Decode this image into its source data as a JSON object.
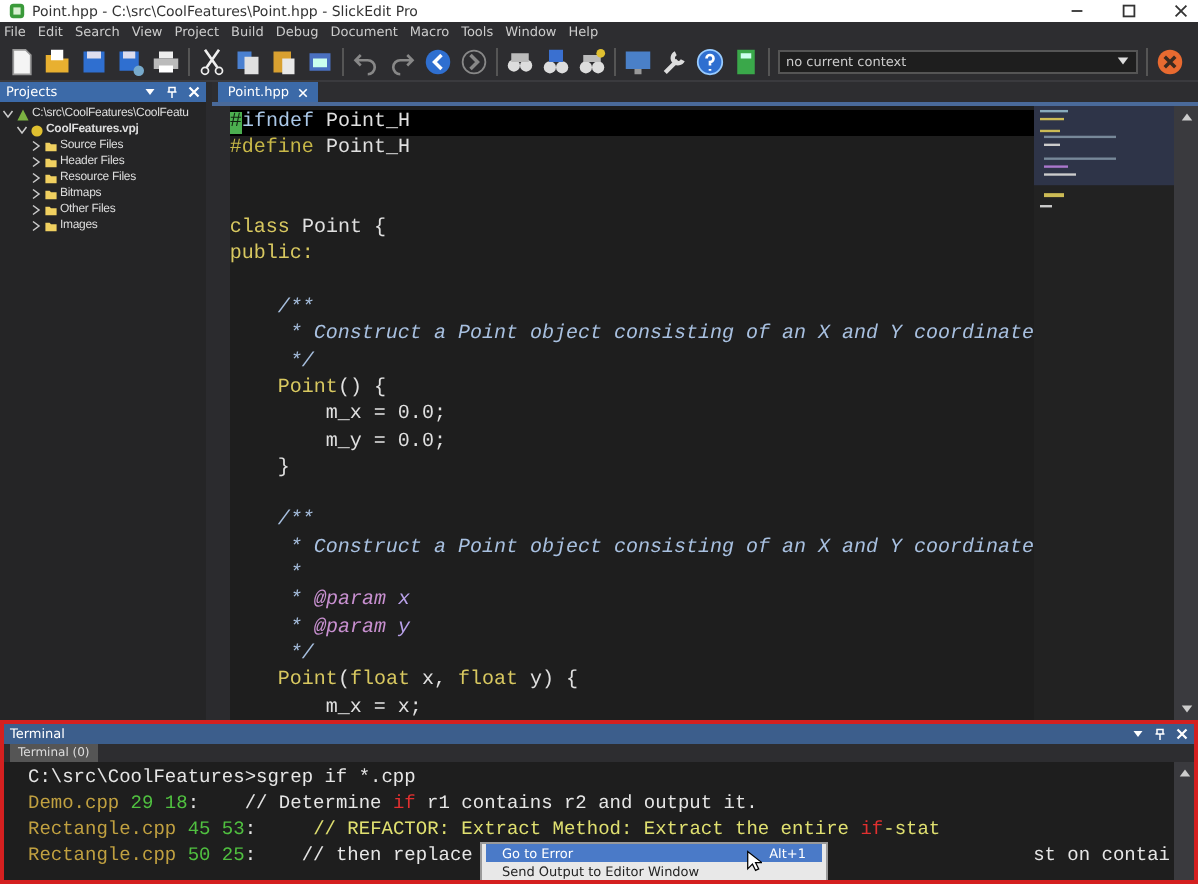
{
  "window": {
    "title": "Point.hpp - C:\\src\\CoolFeatures\\Point.hpp - SlickEdit Pro"
  },
  "menu": [
    "File",
    "Edit",
    "Search",
    "View",
    "Project",
    "Build",
    "Debug",
    "Document",
    "Macro",
    "Tools",
    "Window",
    "Help"
  ],
  "toolbar": {
    "context": {
      "value": "no current context"
    }
  },
  "projects": {
    "title": "Projects",
    "tree": [
      {
        "label": "C:\\src\\CoolFeatures\\CoolFeatu",
        "expanded": true,
        "children": [
          {
            "label": "CoolFeatures.vpj",
            "expanded": true,
            "children": [
              {
                "label": "Source Files",
                "expanded": false
              },
              {
                "label": "Header Files",
                "expanded": false
              },
              {
                "label": "Resource Files",
                "expanded": false
              },
              {
                "label": "Bitmaps",
                "expanded": false
              },
              {
                "label": "Other Files",
                "expanded": false
              },
              {
                "label": "Images",
                "expanded": false
              }
            ]
          }
        ]
      }
    ]
  },
  "editor": {
    "tabs": [
      {
        "label": "Point.hpp",
        "selected": true
      }
    ],
    "lines": [
      {
        "current": true,
        "segments": [
          {
            "kind": "cursor",
            "text": "#"
          },
          {
            "kind": "preproc",
            "text": "ifndef"
          },
          {
            "kind": "ident",
            "text": " Point_H"
          }
        ]
      },
      {
        "current": false,
        "segments": [
          {
            "kind": "define",
            "text": "#define"
          },
          {
            "kind": "ident",
            "text": " Point_H"
          }
        ]
      },
      {
        "current": false,
        "kind": "blank"
      },
      {
        "current": false,
        "kind": "blank"
      },
      {
        "current": false,
        "segments": [
          {
            "kind": "keyword",
            "text": "class"
          },
          {
            "kind": "ident",
            "text": " Point {"
          }
        ]
      },
      {
        "current": false,
        "segments": [
          {
            "kind": "keyword",
            "text": "public:"
          }
        ]
      },
      {
        "current": false,
        "kind": "blank"
      },
      {
        "current": false,
        "segments": [
          {
            "kind": "comment",
            "text": "    /**"
          }
        ]
      },
      {
        "current": false,
        "segments": [
          {
            "kind": "comment",
            "text": "     * Construct a Point object consisting of an X and Y coordinate"
          }
        ]
      },
      {
        "current": false,
        "segments": [
          {
            "kind": "comment",
            "text": "     */"
          }
        ]
      },
      {
        "current": false,
        "segments": [
          {
            "kind": "function",
            "text": "    Point"
          },
          {
            "kind": "ident",
            "text": "() {"
          }
        ]
      },
      {
        "current": false,
        "segments": [
          {
            "kind": "ident",
            "text": "        m_x = 0.0;"
          }
        ]
      },
      {
        "current": false,
        "segments": [
          {
            "kind": "ident",
            "text": "        m_y = 0.0;"
          }
        ]
      },
      {
        "current": false,
        "segments": [
          {
            "kind": "ident",
            "text": "    }"
          }
        ]
      },
      {
        "current": false,
        "kind": "blank"
      },
      {
        "current": false,
        "segments": [
          {
            "kind": "comment",
            "text": "    /**"
          }
        ]
      },
      {
        "current": false,
        "segments": [
          {
            "kind": "comment",
            "text": "     * Construct a Point object consisting of an X and Y coordinate"
          }
        ]
      },
      {
        "current": false,
        "segments": [
          {
            "kind": "comment",
            "text": "     *"
          }
        ]
      },
      {
        "current": false,
        "segments": [
          {
            "kind": "comment",
            "text": "     * "
          },
          {
            "kind": "doctag",
            "text": "@param"
          },
          {
            "kind": "param",
            "text": " x"
          }
        ]
      },
      {
        "current": false,
        "segments": [
          {
            "kind": "comment",
            "text": "     * "
          },
          {
            "kind": "doctag",
            "text": "@param"
          },
          {
            "kind": "param",
            "text": " y"
          }
        ]
      },
      {
        "current": false,
        "segments": [
          {
            "kind": "comment",
            "text": "     */"
          }
        ]
      },
      {
        "current": false,
        "segments": [
          {
            "kind": "function",
            "text": "    Point"
          },
          {
            "kind": "ident",
            "text": "("
          },
          {
            "kind": "keyword",
            "text": "float"
          },
          {
            "kind": "ident",
            "text": " x, "
          },
          {
            "kind": "keyword",
            "text": "float"
          },
          {
            "kind": "ident",
            "text": " y) {"
          }
        ]
      },
      {
        "current": false,
        "segments": [
          {
            "kind": "ident",
            "text": "        m_x = x;"
          }
        ]
      }
    ]
  },
  "terminal": {
    "title": "Terminal",
    "tabs": [
      {
        "label": "Terminal (0)",
        "selected": true
      }
    ],
    "lines": [
      {
        "segments": [
          {
            "kind": "plain",
            "text": "C:\\src\\CoolFeatures>sgrep if *.cpp"
          }
        ]
      },
      {
        "segments": [
          {
            "kind": "file",
            "text": "Demo.cpp"
          },
          {
            "kind": "num",
            "text": " 29 18"
          },
          {
            "kind": "plain",
            "text": ":    // Determine "
          },
          {
            "kind": "match",
            "text": "if"
          },
          {
            "kind": "plain",
            "text": " r1 contains r2 and output it."
          }
        ]
      },
      {
        "segments": [
          {
            "kind": "file",
            "text": "Rectangle.cpp"
          },
          {
            "kind": "num",
            "text": " 45 53"
          },
          {
            "kind": "plain",
            "text": ":     "
          },
          {
            "kind": "todo",
            "text": "// REFACTOR: Extract Method: Extract the entire "
          },
          {
            "kind": "match",
            "text": "if"
          },
          {
            "kind": "todo",
            "text": "-stat"
          }
        ]
      },
      {
        "segments": [
          {
            "kind": "file",
            "text": "Rectangle.cpp"
          },
          {
            "kind": "num",
            "text": " 50 25"
          },
          {
            "kind": "plain",
            "text": ":    // then replace"
          }
        ],
        "after_menu": "st on contai"
      }
    ],
    "context_menu": [
      {
        "label": "Go to Error",
        "shortcut": "Alt+1",
        "selected": true
      },
      {
        "label": "Send Output to Editor Window",
        "selected": false
      }
    ]
  }
}
